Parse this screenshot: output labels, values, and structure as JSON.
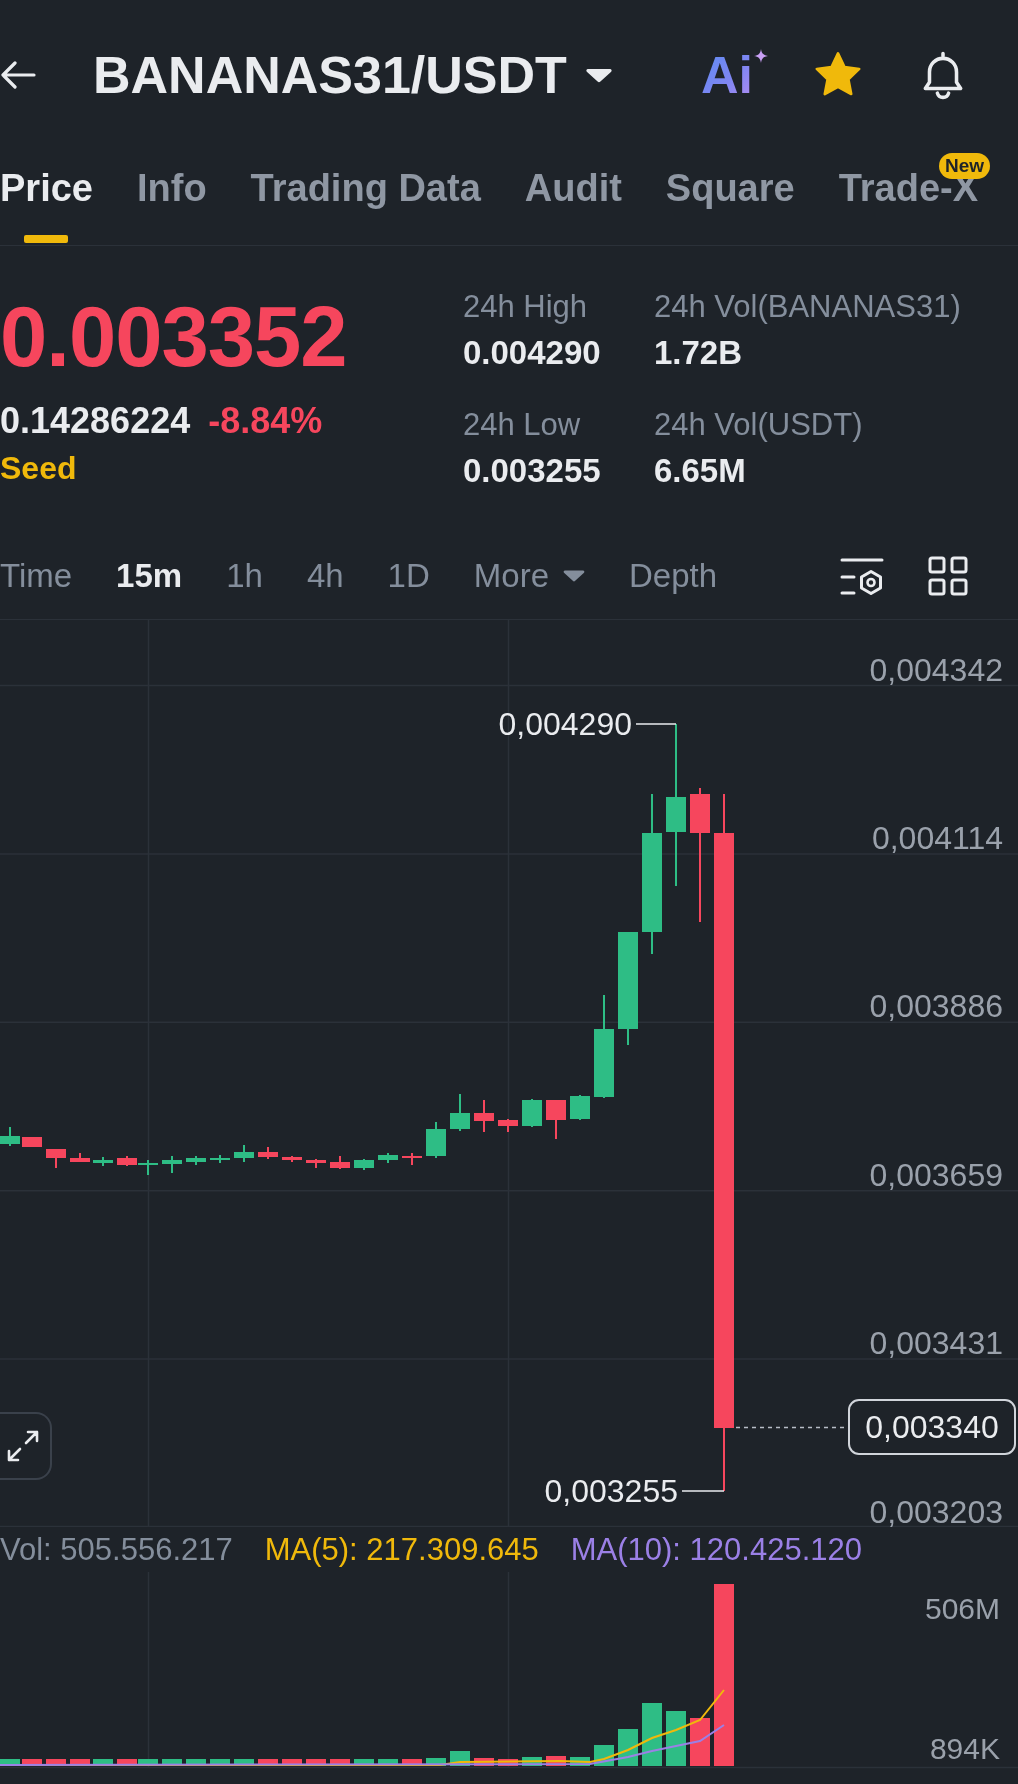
{
  "header": {
    "title": "BANANAS31/USDT",
    "ai_label": "Ai",
    "favorite": true
  },
  "tabs": [
    {
      "label": "Price",
      "selected": true
    },
    {
      "label": "Info",
      "selected": false
    },
    {
      "label": "Trading Data",
      "selected": false
    },
    {
      "label": "Audit",
      "selected": false
    },
    {
      "label": "Square",
      "selected": false
    },
    {
      "label": "Trade-X",
      "selected": false,
      "badge": "New"
    }
  ],
  "ticker": {
    "price": "0.003352",
    "change": "0.14286224",
    "change_percent": "-8.84%",
    "tag": "Seed"
  },
  "stats": [
    {
      "label": "24h High",
      "value": "0.004290"
    },
    {
      "label": "24h Vol(BANANAS31)",
      "value": "1.72B"
    },
    {
      "label": "24h Low",
      "value": "0.003255"
    },
    {
      "label": "24h Vol(USDT)",
      "value": "6.65M"
    }
  ],
  "chart_tabs": [
    {
      "label": "Time",
      "selected": false,
      "kind": "option"
    },
    {
      "label": "15m",
      "selected": true,
      "kind": "option"
    },
    {
      "label": "1h",
      "selected": false,
      "kind": "option"
    },
    {
      "label": "4h",
      "selected": false,
      "kind": "option"
    },
    {
      "label": "1D",
      "selected": false,
      "kind": "option"
    },
    {
      "label": "More",
      "selected": false,
      "kind": "dropdown"
    },
    {
      "label": "Depth",
      "selected": false,
      "kind": "option"
    }
  ],
  "chart": {
    "price_axis": [
      "0,004342",
      "0,004114",
      "0,003886",
      "0,003659",
      "0,003431",
      "0,003203"
    ],
    "high_label": "0,004290",
    "low_label": "0,003255",
    "last_price": "0,003340"
  },
  "volume": {
    "indicators": [
      {
        "text": "Vol: 505.556.217",
        "color": "#848e9c"
      },
      {
        "text": "MA(5): 217.309.645",
        "color": "#f0b90b"
      },
      {
        "text": "MA(10): 120.425.120",
        "color": "#9b80e6"
      }
    ],
    "axis": [
      "506M",
      "894K"
    ]
  }
}
